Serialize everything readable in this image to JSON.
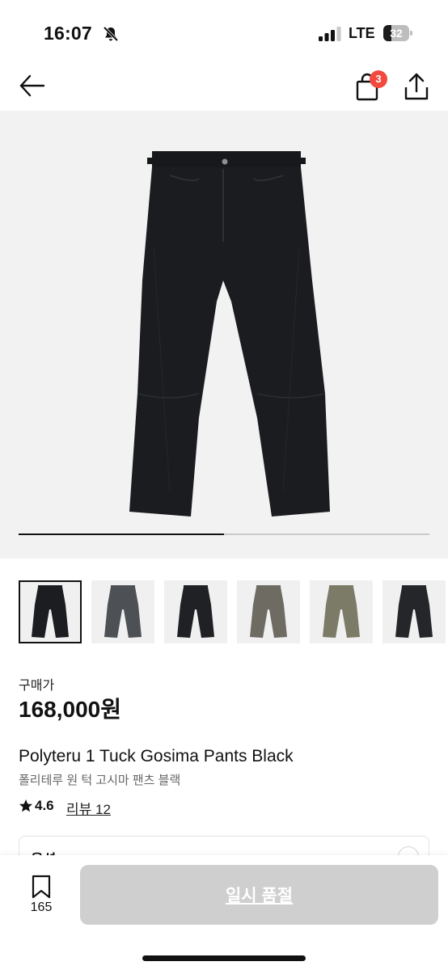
{
  "status_bar": {
    "time": "16:07",
    "network": "LTE",
    "battery": "32",
    "battery_level": 0.32,
    "icons": [
      "bell-slash-icon",
      "signal-bars-icon",
      "battery-icon"
    ]
  },
  "nav": {
    "cart_badge": "3",
    "icons": [
      "back-arrow-icon",
      "shopping-bag-icon",
      "share-icon"
    ]
  },
  "gallery": {
    "image": "black-wide-pants-photo",
    "image_count": 2,
    "current_index": 1,
    "progress": 0.5,
    "thumbnails": [
      {
        "name": "pants-black",
        "color": "#1b1d20",
        "selected": true
      },
      {
        "name": "pants-charcoal",
        "color": "#4d5055",
        "selected": false
      },
      {
        "name": "pants-black-washed",
        "color": "#202124",
        "selected": false
      },
      {
        "name": "pants-grey",
        "color": "#6e6b63",
        "selected": false
      },
      {
        "name": "pants-khaki",
        "color": "#7b7b68",
        "selected": false
      },
      {
        "name": "pants-black-2",
        "color": "#24262a",
        "selected": false
      }
    ]
  },
  "price": {
    "label": "구매가",
    "value": "168,000원"
  },
  "product": {
    "name": "Polyteru 1 Tuck Gosima Pants Black",
    "subname": "폴리테루 원 턱 고시마 팬츠 블랙",
    "rating": "4.6",
    "review_link": "리뷰 12"
  },
  "option": {
    "label": "옵션"
  },
  "bottom_bar": {
    "wishlist_count": "165",
    "action_button": "일시 품절",
    "colors": {
      "button_bg": "#cfcfcf",
      "badge": "#f24a3f"
    }
  }
}
